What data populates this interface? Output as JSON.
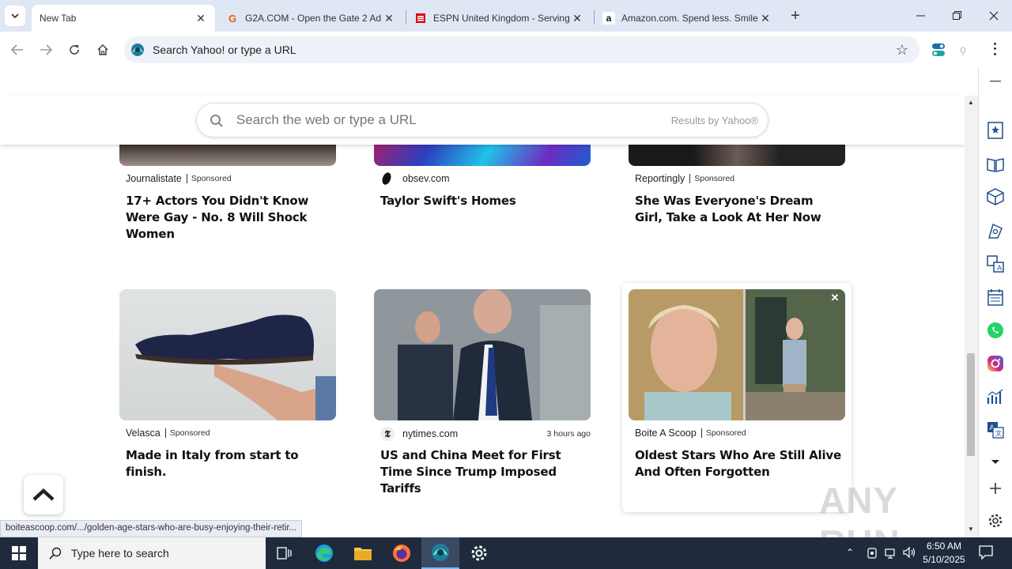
{
  "tabs": [
    {
      "label": "New Tab",
      "active": true
    },
    {
      "label": "G2A.COM - Open the Gate 2 Ad",
      "icon": "g2a-icon"
    },
    {
      "label": "ESPN United Kingdom - Serving",
      "icon": "espn-icon"
    },
    {
      "label": "Amazon.com. Spend less. Smile",
      "icon": "amazon-icon"
    }
  ],
  "omnibox": {
    "placeholder": "Search Yahoo! or type a URL"
  },
  "search": {
    "placeholder": "Search the web or type a URL",
    "results_by": "Results by Yahoo®"
  },
  "cards_top": [
    {
      "source": "Journalistate",
      "sponsored": "Sponsored",
      "title": "17+ Actors You Didn't Know Were Gay - No. 8 Will Shock Women"
    },
    {
      "source": "obsev.com",
      "sponsored": "",
      "title": "Taylor Swift's Homes"
    },
    {
      "source": "Reportingly",
      "sponsored": "Sponsored",
      "title": "She Was Everyone's Dream Girl, Take a Look At Her Now"
    }
  ],
  "cards_bottom": [
    {
      "source": "Velasca",
      "sponsored": "Sponsored",
      "title": "Made in Italy from start to finish."
    },
    {
      "source": "nytimes.com",
      "time": "3 hours ago",
      "title": "US and China Meet for First Time Since Trump Imposed Tariffs"
    },
    {
      "source": "Boite A Scoop",
      "sponsored": "Sponsored",
      "title": "Oldest Stars Who Are Still Alive And Often Forgotten"
    }
  ],
  "status_url": "boiteascoop.com/.../golden-age-stars-who-are-busy-enjoying-their-retir...",
  "taskbar": {
    "search_placeholder": "Type here to search",
    "time": "6:50 AM",
    "date": "5/10/2025"
  },
  "watermark": "ANY RUN"
}
